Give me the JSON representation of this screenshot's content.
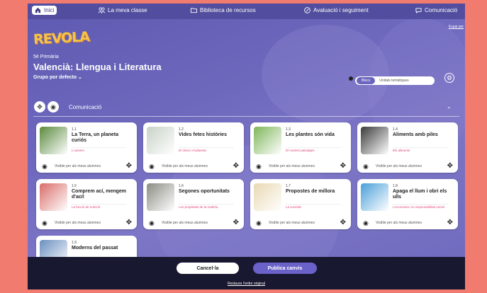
{
  "nav": {
    "home": "Inici",
    "class": "La meva classe",
    "library": "Biblioteca de recursos",
    "evaluation": "Avaluació i seguiment",
    "communication": "Comunicació"
  },
  "skip_link": "Espai per",
  "logo": "REVOLA",
  "grade": "5è Primària",
  "title": "Valencià: Llengua i Literatura",
  "group": "Grupo por defecto",
  "view_toggle": {
    "active": "Blocs",
    "inactive": "Unitats temàtiques"
  },
  "section": {
    "title": "Comunicació"
  },
  "visible_label": "Visible per als meus alumnes",
  "units": [
    {
      "num": "1.1",
      "name": "La Terra, un planeta curiós",
      "tag": "L'univers",
      "color": "#5a8a3c"
    },
    {
      "num": "1.2",
      "name": "Vides fetes històries",
      "tag": "El clima i el planeta",
      "color": "#c9d2c8"
    },
    {
      "num": "1.3",
      "name": "Les plantes són vida",
      "tag": "El nostres paisatges",
      "color": "#7fb65a"
    },
    {
      "num": "1.4",
      "name": "Aliments amb piles",
      "tag": "Els aliments",
      "color": "#3b3b3b"
    },
    {
      "num": "1.5",
      "name": "Comprem ací, mengem d'ací!",
      "tag": "La funció de nutrició",
      "color": "#d96d6a"
    },
    {
      "num": "1.6",
      "name": "Segones oportunitats",
      "tag": "Les propietats de la matèria",
      "color": "#8c8c84"
    },
    {
      "num": "1.7",
      "name": "Propostes de millora",
      "tag": "La societat",
      "color": "#e9d9b4"
    },
    {
      "num": "1.8",
      "name": "Apaga el llum i obri els ulls",
      "tag": "L'economia i la responsabilitat social",
      "color": "#4a9fd8"
    },
    {
      "num": "1.9",
      "name": "Moderns del passat",
      "tag": "",
      "color": "#6a8fbf"
    }
  ],
  "footer": {
    "cancel": "Cancel·la",
    "publish": "Publica canvis",
    "restore": "Restaura l'ordre original"
  }
}
